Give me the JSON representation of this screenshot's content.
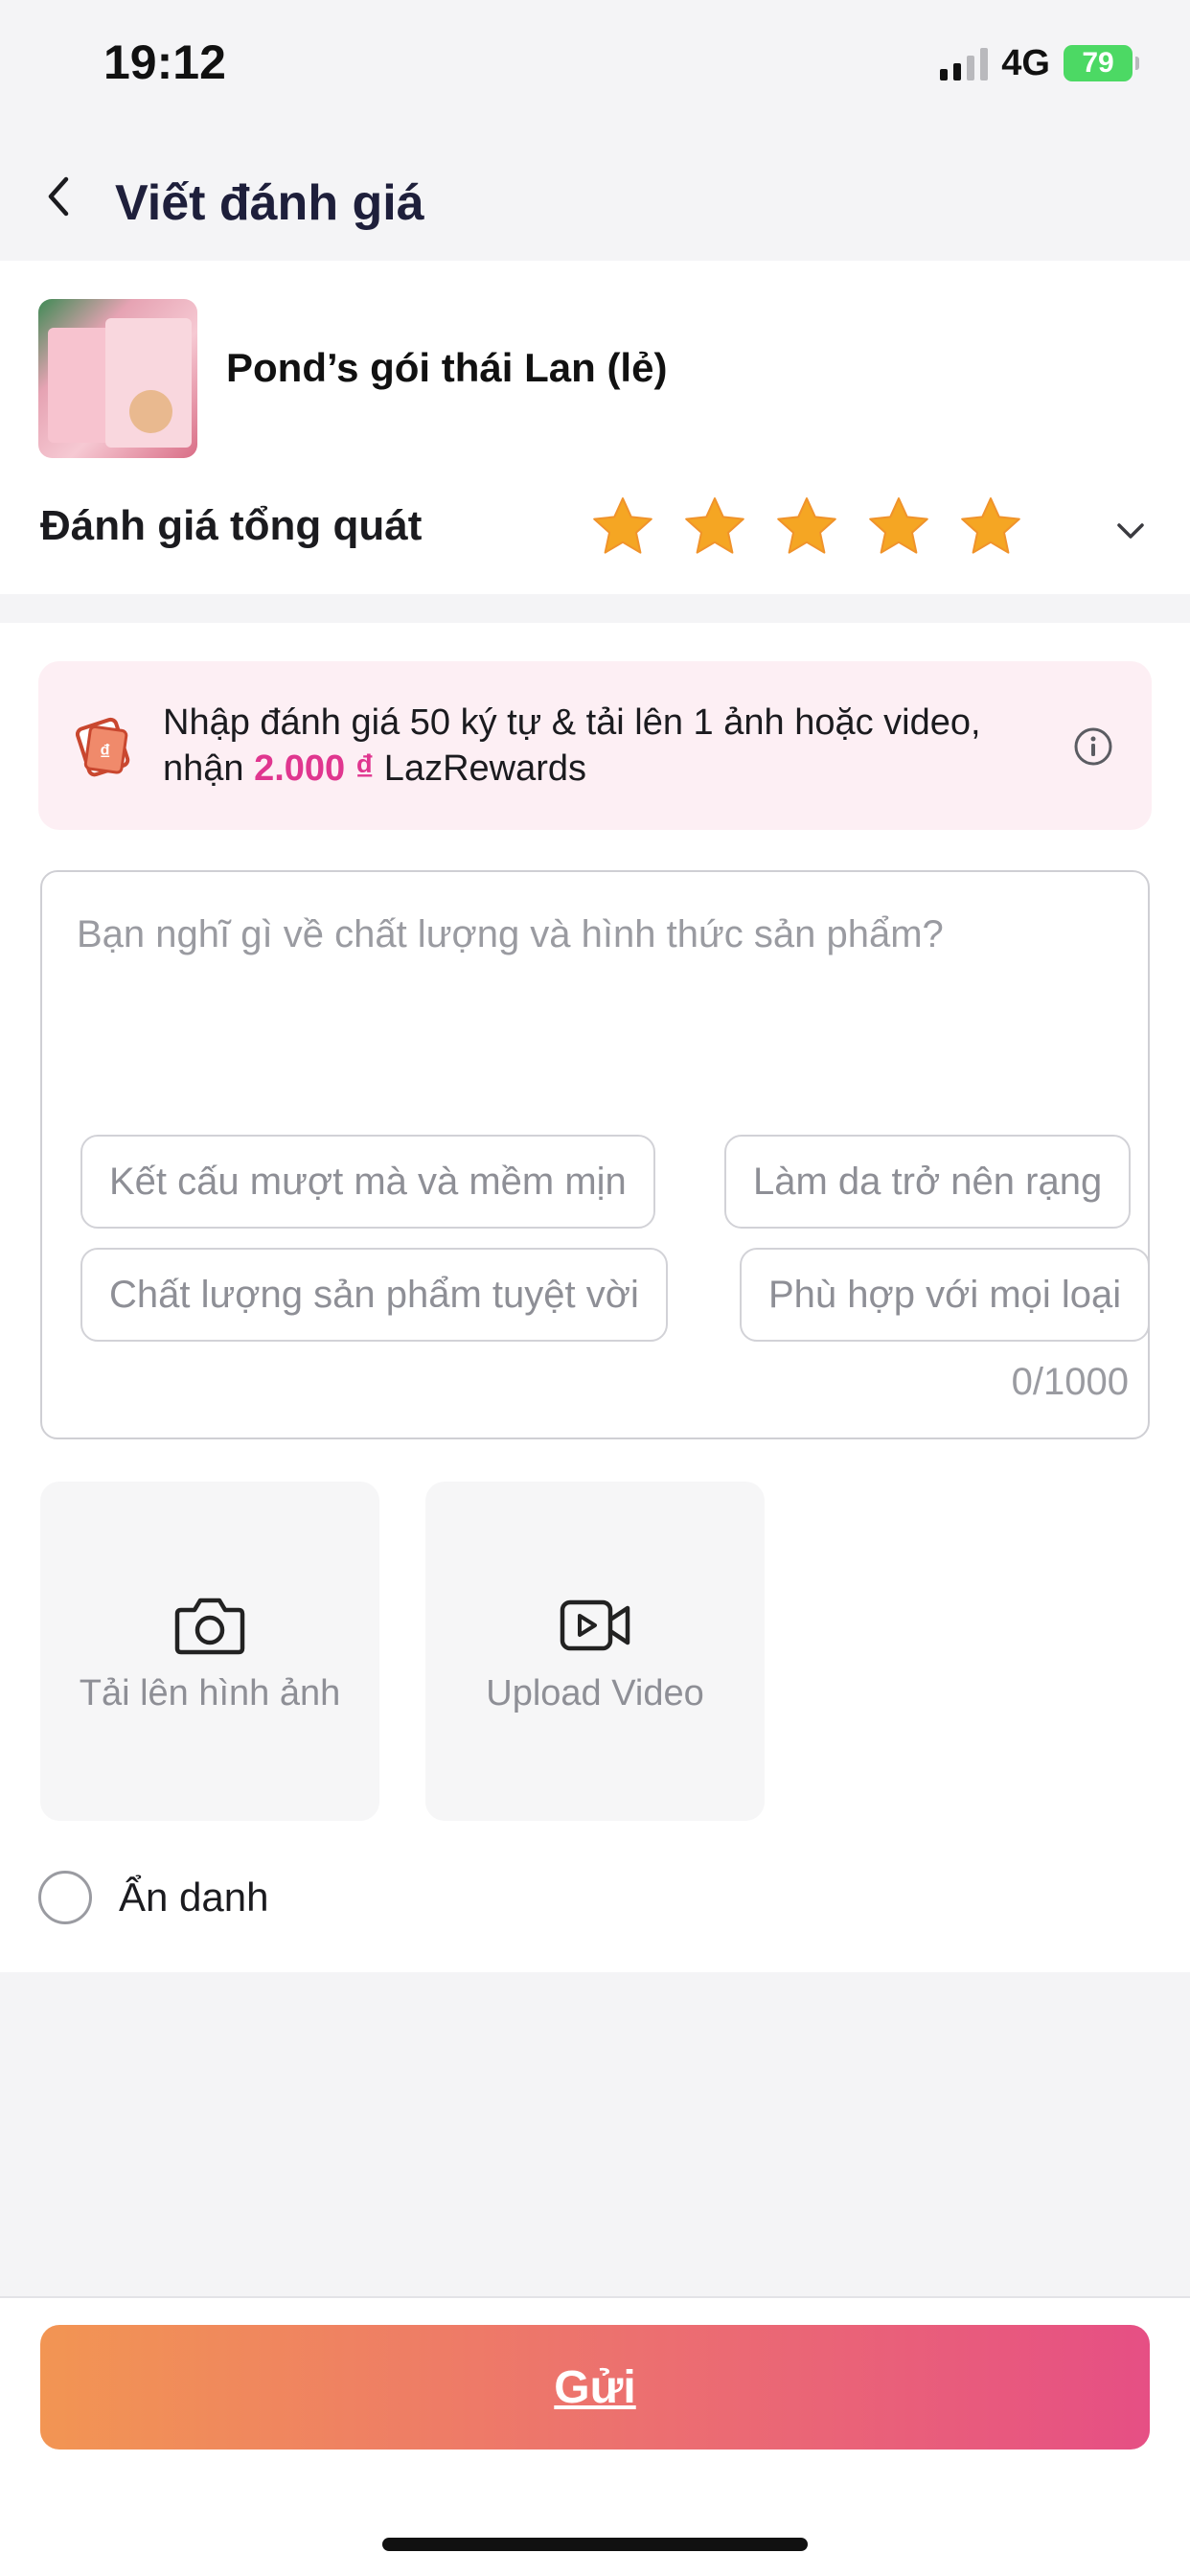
{
  "status_bar": {
    "time": "19:12",
    "network": "4G",
    "battery": "79",
    "signal_bars_active": 2,
    "signal_bars_total": 4
  },
  "header": {
    "title": "Viết đánh giá",
    "back_icon": "chevron-left-icon"
  },
  "product": {
    "name": "Pond’s gói thái Lan (lẻ)",
    "rating_label": "Đánh giá tổng quát",
    "rating": 5,
    "rating_max": 5,
    "star_color": "#f5a623"
  },
  "promo": {
    "text_before": "Nhập đánh giá 50 ký tự & tải lên 1 ảnh hoặc video, nhận ",
    "amount": "2.000 ₫",
    "text_after": " LazRewards",
    "amount_color": "#e0368f"
  },
  "review": {
    "placeholder": "Bạn nghĩ gì về chất lượng và hình thức sản phẩm?",
    "value": "",
    "suggestions": [
      "Kết cấu mượt mà và mềm mịn",
      "Làm da trở nên rạng",
      "Chất lượng sản phẩm tuyệt vời",
      "Phù hợp với mọi loại"
    ],
    "counter": "0/1000"
  },
  "uploads": {
    "photo_label": "Tải lên hình ảnh",
    "video_label": "Upload Video"
  },
  "anonymous": {
    "label": "Ẩn danh",
    "checked": false
  },
  "submit": {
    "label": "Gửi"
  }
}
